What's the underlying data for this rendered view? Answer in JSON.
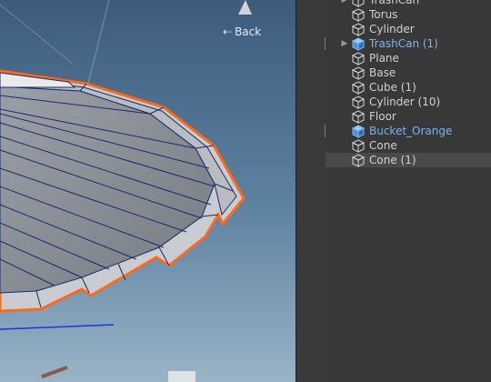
{
  "scene": {
    "back_label": "Back",
    "back_icon": "back-arrow-icon",
    "selection_outline_color": "#ff6a1a",
    "mesh_color": "#8e949a",
    "wire_color": "#1b2a6b",
    "sky_top": "#3d5c7c",
    "sky_bottom": "#93b0c6"
  },
  "hierarchy": {
    "items": [
      {
        "label": "TrashCan",
        "prefab": false,
        "foldout": true
      },
      {
        "label": "Torus",
        "prefab": false,
        "foldout": false
      },
      {
        "label": "Cylinder",
        "prefab": false,
        "foldout": false
      },
      {
        "label": "TrashCan (1)",
        "prefab": true,
        "foldout": true
      },
      {
        "label": "Plane",
        "prefab": false,
        "foldout": false
      },
      {
        "label": "Base",
        "prefab": false,
        "foldout": false
      },
      {
        "label": "Cube (1)",
        "prefab": false,
        "foldout": false
      },
      {
        "label": "Cylinder (10)",
        "prefab": false,
        "foldout": false
      },
      {
        "label": "Floor",
        "prefab": false,
        "foldout": false
      },
      {
        "label": "Bucket_Orange",
        "prefab": true,
        "foldout": false
      },
      {
        "label": "Cone",
        "prefab": false,
        "foldout": false
      },
      {
        "label": "Cone (1)",
        "prefab": false,
        "foldout": false
      }
    ],
    "gameobject_icon": "gameobject-cube-icon",
    "prefab_icon": "prefab-cube-icon",
    "prefab_color": "#7cb3ec",
    "marker_color": "#3d8de6"
  }
}
